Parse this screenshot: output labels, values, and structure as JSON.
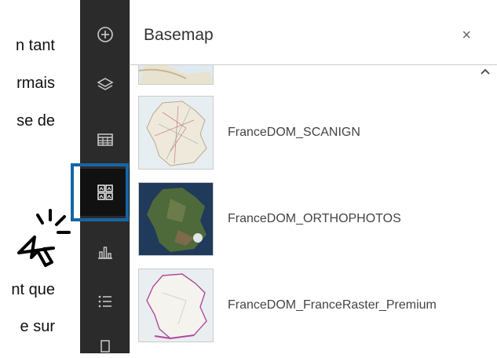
{
  "doc": {
    "line1": "n tant",
    "line2": "rmais",
    "line3": "se de",
    "line4": "nt que",
    "line5": "e sur"
  },
  "panel": {
    "title": "Basemap",
    "close": "×"
  },
  "sidebar": {
    "items": [
      {
        "name": "add-data",
        "icon": "plus-circle-icon"
      },
      {
        "name": "layers",
        "icon": "layers-icon"
      },
      {
        "name": "attribute-table",
        "icon": "table-icon"
      },
      {
        "name": "basemap-gallery",
        "icon": "basemap-icon",
        "active": true
      },
      {
        "name": "chart",
        "icon": "bar-chart-icon"
      },
      {
        "name": "legend",
        "icon": "list-icon"
      }
    ]
  },
  "basemaps": [
    {
      "label": "FranceDOM_SCANIGN"
    },
    {
      "label": "FranceDOM_ORTHOPHOTOS"
    },
    {
      "label": "FranceDOM_FranceRaster_Premium"
    }
  ],
  "colors": {
    "sidebar": "#2b2b2b",
    "highlight": "#1566a6"
  }
}
